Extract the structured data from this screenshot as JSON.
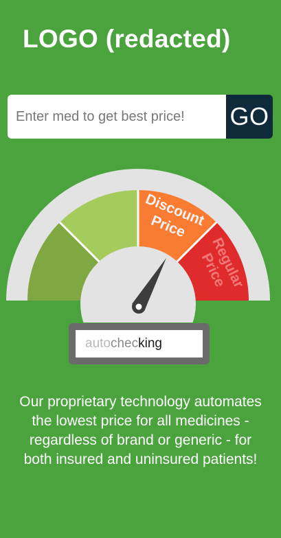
{
  "header": {
    "logo_text": "LOGO (redacted)"
  },
  "search": {
    "placeholder": "Enter med to get best price!",
    "value": "",
    "go_label": "GO"
  },
  "gauge": {
    "segments": [
      {
        "name": "low",
        "color": "#7fa843"
      },
      {
        "name": "mid",
        "color": "#a6cb5d"
      },
      {
        "name": "discount",
        "label_line1": "Discount",
        "label_line2": "Price",
        "color": "#f97c32"
      },
      {
        "name": "regular",
        "label_line1": "Regular",
        "label_line2": "Price",
        "color": "#df2b2b"
      }
    ],
    "outer_ring_color": "#e3e3e3",
    "needle_color": "#3d3d3d",
    "status_text_part1": "auto ",
    "status_text_part2": "chec",
    "status_text_part3": "king"
  },
  "description": {
    "text": "Our proprietary technology automates the lowest price for all medicines - regardless of brand or generic - for both insured and uninsured patients!"
  },
  "colors": {
    "background": "#4aa33d",
    "go_button": "#0f2a3a"
  }
}
